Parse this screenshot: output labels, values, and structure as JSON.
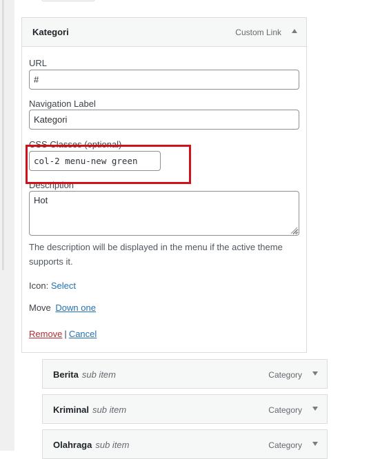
{
  "menu_item": {
    "title": "Kategori",
    "type_label": "Custom Link",
    "url_label": "URL",
    "url_value": "#",
    "nav_label_label": "Navigation Label",
    "nav_label_value": "Kategori",
    "css_label": "CSS Classes (optional)",
    "css_value": "col-2 menu-new green",
    "description_label": "Description",
    "description_value": "Hot",
    "description_help": "The description will be displayed in the menu if the active theme supports it.",
    "icon_label": "Icon:",
    "icon_select_link": "Select",
    "move_label": "Move",
    "move_down_link": "Down one",
    "remove_link": "Remove",
    "separator": "|",
    "cancel_link": "Cancel"
  },
  "sub_items": [
    {
      "title": "Berita",
      "tag": "sub item",
      "type": "Category"
    },
    {
      "title": "Kriminal",
      "tag": "sub item",
      "type": "Category"
    },
    {
      "title": "Olahraga",
      "tag": "sub item",
      "type": "Category"
    }
  ],
  "colors": {
    "link": "#2271b1",
    "delete": "#b32d2e",
    "highlight": "#d0101a",
    "header_bg": "#f6f7f7",
    "border": "#dcdcde"
  },
  "icons": {
    "toggle": "triangle-up-icon",
    "sub_toggle": "triangle-down-icon"
  }
}
